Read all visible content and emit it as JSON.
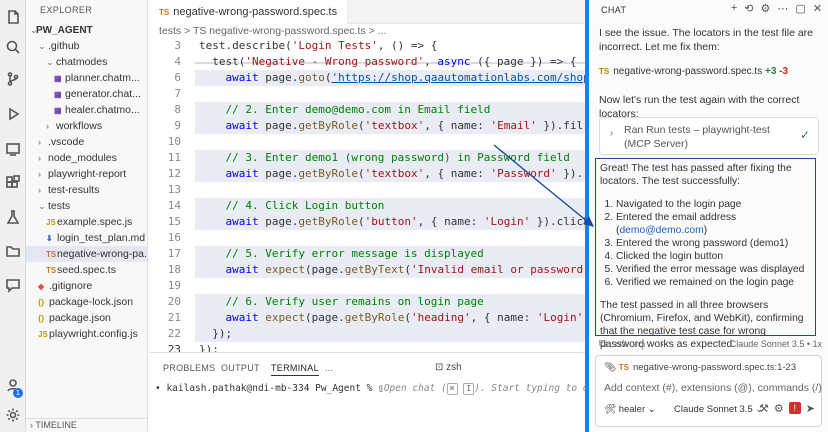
{
  "explorer": {
    "title": "EXPLORER",
    "project": "PW_AGENT",
    "items": [
      {
        "label": ".github",
        "kind": "folder-open",
        "indent": 1
      },
      {
        "label": "chatmodes",
        "kind": "folder-open",
        "indent": 2
      },
      {
        "label": "planner.chatm...",
        "kind": "chatmode",
        "indent": 3
      },
      {
        "label": "generator.chat...",
        "kind": "chatmode",
        "indent": 3
      },
      {
        "label": "healer.chatmo...",
        "kind": "chatmode",
        "indent": 3
      },
      {
        "label": "workflows",
        "kind": "folder",
        "indent": 2
      },
      {
        "label": ".vscode",
        "kind": "folder",
        "indent": 1
      },
      {
        "label": "node_modules",
        "kind": "folder",
        "indent": 1
      },
      {
        "label": "playwright-report",
        "kind": "folder",
        "indent": 1
      },
      {
        "label": "test-results",
        "kind": "folder",
        "indent": 1
      },
      {
        "label": "tests",
        "kind": "folder-open",
        "indent": 1
      },
      {
        "label": "example.spec.js",
        "kind": "js",
        "indent": 2
      },
      {
        "label": "login_test_plan.md",
        "kind": "md",
        "indent": 2
      },
      {
        "label": "negative-wrong-pa...",
        "kind": "ts",
        "indent": 2,
        "selected": true
      },
      {
        "label": "seed.spec.ts",
        "kind": "ts",
        "indent": 2
      },
      {
        "label": ".gitignore",
        "kind": "git",
        "indent": 1
      },
      {
        "label": "package-lock.json",
        "kind": "json",
        "indent": 1
      },
      {
        "label": "package.json",
        "kind": "json",
        "indent": 1
      },
      {
        "label": "playwright.config.js",
        "kind": "js",
        "indent": 1
      }
    ],
    "timeline": "TIMELINE"
  },
  "editor": {
    "tab_badge": "TS",
    "tab_label": "negative-wrong-password.spec.ts",
    "breadcrumb": "tests > TS negative-wrong-password.spec.ts > ..."
  },
  "code": [
    {
      "n": "3",
      "segs": [
        [
          "p",
          "test.describe("
        ],
        [
          "s",
          "'Login Tests'"
        ],
        [
          "p",
          ", () => {"
        ]
      ]
    },
    {
      "n": "4",
      "segs": [
        [
          "p",
          "  test("
        ],
        [
          "s",
          "'Negative - Wrong password'"
        ],
        [
          "p",
          ", "
        ],
        [
          "k",
          "async"
        ],
        [
          "p",
          " ({ page }) => {"
        ]
      ]
    },
    {
      "n": "6",
      "segs": [
        [
          "p",
          "    "
        ],
        [
          "k",
          "await"
        ],
        [
          "p",
          " page."
        ],
        [
          "f",
          "goto"
        ],
        [
          "p",
          "("
        ],
        [
          "u",
          "'https://shop.qaautomationlabs.com/shop"
        ]
      ],
      "hl": true
    },
    {
      "n": "7",
      "segs": []
    },
    {
      "n": "8",
      "segs": [
        [
          "c",
          "    // 2. Enter demo@demo.com in Email field"
        ]
      ],
      "hl": true
    },
    {
      "n": "9",
      "segs": [
        [
          "p",
          "    "
        ],
        [
          "k",
          "await"
        ],
        [
          "p",
          " page."
        ],
        [
          "f",
          "getByRole"
        ],
        [
          "p",
          "("
        ],
        [
          "s",
          "'textbox'"
        ],
        [
          "p",
          ", { name: "
        ],
        [
          "s",
          "'Email'"
        ],
        [
          "p",
          " }).fil"
        ]
      ],
      "hl": true
    },
    {
      "n": "10",
      "segs": []
    },
    {
      "n": "11",
      "segs": [
        [
          "c",
          "    // 3. Enter demo1 (wrong password) in Password field"
        ]
      ],
      "hl": true
    },
    {
      "n": "12",
      "segs": [
        [
          "p",
          "    "
        ],
        [
          "k",
          "await"
        ],
        [
          "p",
          " page."
        ],
        [
          "f",
          "getByRole"
        ],
        [
          "p",
          "("
        ],
        [
          "s",
          "'textbox'"
        ],
        [
          "p",
          ", { name: "
        ],
        [
          "s",
          "'Password'"
        ],
        [
          "p",
          " })."
        ]
      ],
      "hl": true
    },
    {
      "n": "13",
      "segs": []
    },
    {
      "n": "14",
      "segs": [
        [
          "c",
          "    // 4. Click Login button"
        ]
      ],
      "hl": true
    },
    {
      "n": "15",
      "segs": [
        [
          "p",
          "    "
        ],
        [
          "k",
          "await"
        ],
        [
          "p",
          " page."
        ],
        [
          "f",
          "getByRole"
        ],
        [
          "p",
          "("
        ],
        [
          "s",
          "'button'"
        ],
        [
          "p",
          ", { name: "
        ],
        [
          "s",
          "'Login'"
        ],
        [
          "p",
          " }).click"
        ]
      ],
      "hl": true
    },
    {
      "n": "16",
      "segs": []
    },
    {
      "n": "17",
      "segs": [
        [
          "c",
          "    // 5. Verify error message is displayed"
        ]
      ],
      "hl": true
    },
    {
      "n": "18",
      "segs": [
        [
          "p",
          "    "
        ],
        [
          "k",
          "await"
        ],
        [
          "p",
          " "
        ],
        [
          "f",
          "expect"
        ],
        [
          "p",
          "(page."
        ],
        [
          "f",
          "getByText"
        ],
        [
          "p",
          "("
        ],
        [
          "s",
          "'Invalid email or password"
        ]
      ],
      "hl": true
    },
    {
      "n": "19",
      "segs": []
    },
    {
      "n": "20",
      "segs": [
        [
          "c",
          "    // 6. Verify user remains on login page"
        ]
      ],
      "hl": true
    },
    {
      "n": "21",
      "segs": [
        [
          "p",
          "    "
        ],
        [
          "k",
          "await"
        ],
        [
          "p",
          " "
        ],
        [
          "f",
          "expect"
        ],
        [
          "p",
          "(page."
        ],
        [
          "f",
          "getByRole"
        ],
        [
          "p",
          "("
        ],
        [
          "s",
          "'heading'"
        ],
        [
          "p",
          ", { name: "
        ],
        [
          "s",
          "'Login'"
        ]
      ],
      "hl": true
    },
    {
      "n": "22",
      "segs": [
        [
          "p",
          "  });"
        ]
      ],
      "hl": true
    },
    {
      "n": "23",
      "segs": [
        [
          "p",
          "});"
        ]
      ],
      "active": true
    }
  ],
  "panel": {
    "tabs": [
      "PROBLEMS",
      "OUTPUT",
      "TERMINAL",
      "..."
    ],
    "active_tab": "TERMINAL",
    "shell": "zsh",
    "prompt": "kailash.pathak@ndi-mb-334 Pw_Agent %",
    "hint_pre": "Open chat (",
    "kbd1": "⌘",
    "kbd2": "I",
    "hint_post": "). Start typing to dismiss."
  },
  "chat": {
    "title": "CHAT",
    "intro": "I see the issue. The locators in the test file are incorrect. Let me fix them:",
    "file_badge": "TS",
    "file_name": "negative-wrong-password.spec.ts",
    "added": "+3",
    "removed": "-3",
    "run_text": "Now let's run the test again with the correct locators:",
    "tool_label": "Ran Run tests – playwright-test (MCP Server)",
    "answer_p1": "Great! The test has passed after fixing the locators. The test successfully:",
    "steps": [
      "Navigated to the login page",
      "Entered the email address (",
      "Entered the wrong password (demo1)",
      "Clicked the login button",
      "Verified the error message was displayed",
      "Verified we remained on the login page"
    ],
    "email_link": "demo@demo.com",
    "step2_close": ")",
    "answer_p2": "The test passed in all three browsers (Chromium, Firefox, and WebKit), confirming that the negative test case for wrong password works as expected.",
    "model_note": "Claude Sonnet 3.5 • 1x",
    "context_chip": "negative-wrong-password.spec.ts:1-23",
    "input_placeholder": "Add context (#), extensions (@), commands (/)",
    "mode": "healer",
    "model": "Claude Sonnet 3.5"
  },
  "colors": {
    "accent": "#0a84ff",
    "answer_border": "#1a4c9c",
    "arrow": "#1a4c9c"
  }
}
